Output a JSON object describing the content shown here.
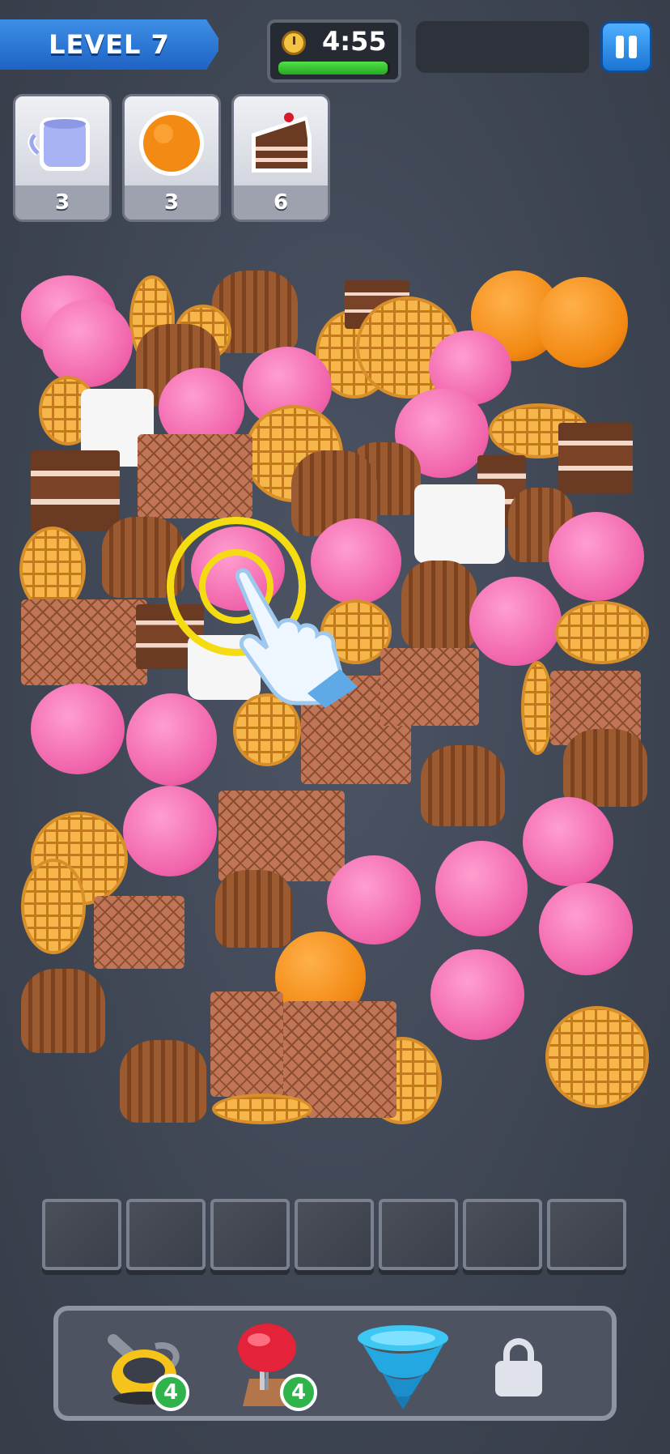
{
  "hud": {
    "level_label": "LEVEL 7",
    "timer_text": "4:55",
    "timer_fraction_remaining": 0.98
  },
  "goals": [
    {
      "item": "mug",
      "count": "3"
    },
    {
      "item": "orange",
      "count": "3"
    },
    {
      "item": "cake-slice",
      "count": "6"
    }
  ],
  "tray": {
    "slot_count": 7
  },
  "boosters": [
    {
      "name": "vacuum-icon",
      "count": "4"
    },
    {
      "name": "boxing-glove-icon",
      "count": "4"
    },
    {
      "name": "tornado-icon",
      "count": ""
    },
    {
      "name": "lock-icon",
      "count": ""
    }
  ],
  "colors": {
    "accent_blue": "#1f63c4",
    "pig_pink": "#f062aa",
    "waffle_gold": "#f6b64a",
    "timer_green": "#22a81e",
    "badge_green": "#2fb34a"
  }
}
